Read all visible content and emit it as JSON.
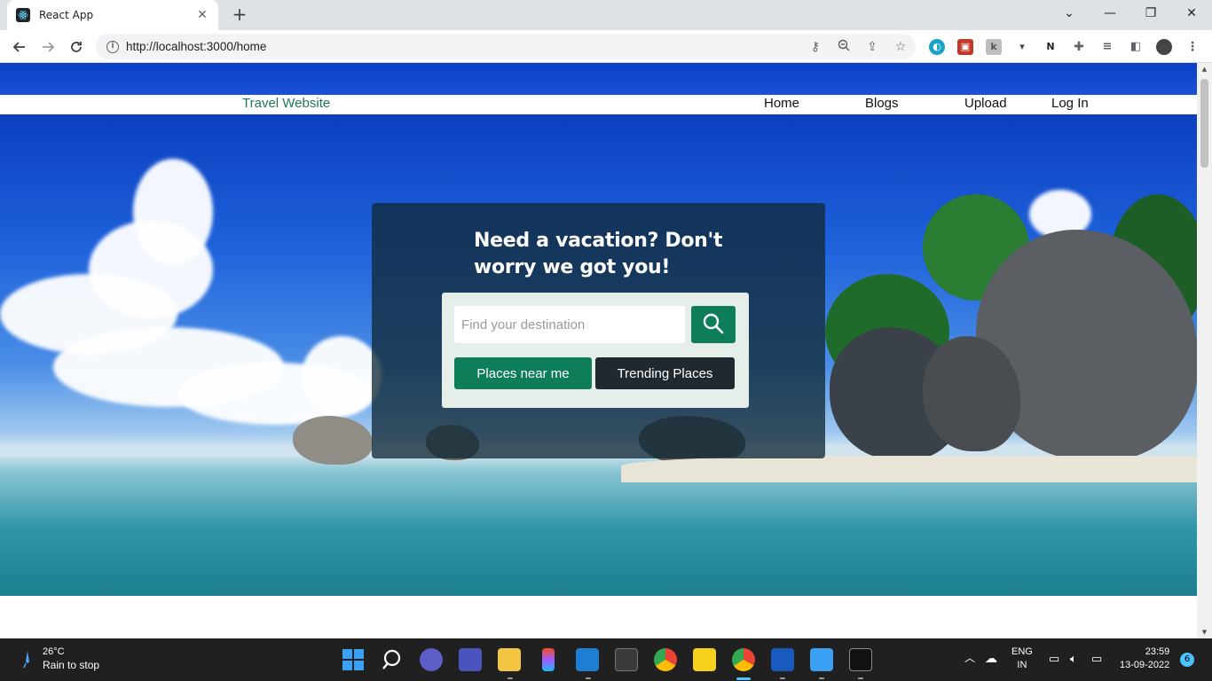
{
  "browser": {
    "tab_title": "React App",
    "tab_close": "✕",
    "new_tab": "+",
    "url": "http://localhost:3000/home",
    "window_controls": [
      "⌄",
      "—",
      "❐",
      "✕"
    ]
  },
  "site": {
    "brand": "Travel Website",
    "nav": [
      "Home",
      "Blogs",
      "Upload",
      "Log In"
    ],
    "headline": "Need a vacation? Don't worry we got you!",
    "search_placeholder": "Find your destination",
    "search_value": "",
    "btn_near": "Places near me",
    "btn_trending": "Trending Places"
  },
  "taskbar": {
    "temperature": "26°C",
    "weather": "Rain to stop",
    "lang": "ENG",
    "region": "IN",
    "time": "23:59",
    "date": "13-09-2022",
    "notifications": "6"
  },
  "colors": {
    "brand": "#1f7a52",
    "primary_button": "#0e7e5a",
    "dark_button": "#212930"
  },
  "icons": {
    "search": "search-icon",
    "back": "back-arrow-icon",
    "forward": "forward-arrow-icon",
    "reload": "reload-icon"
  }
}
